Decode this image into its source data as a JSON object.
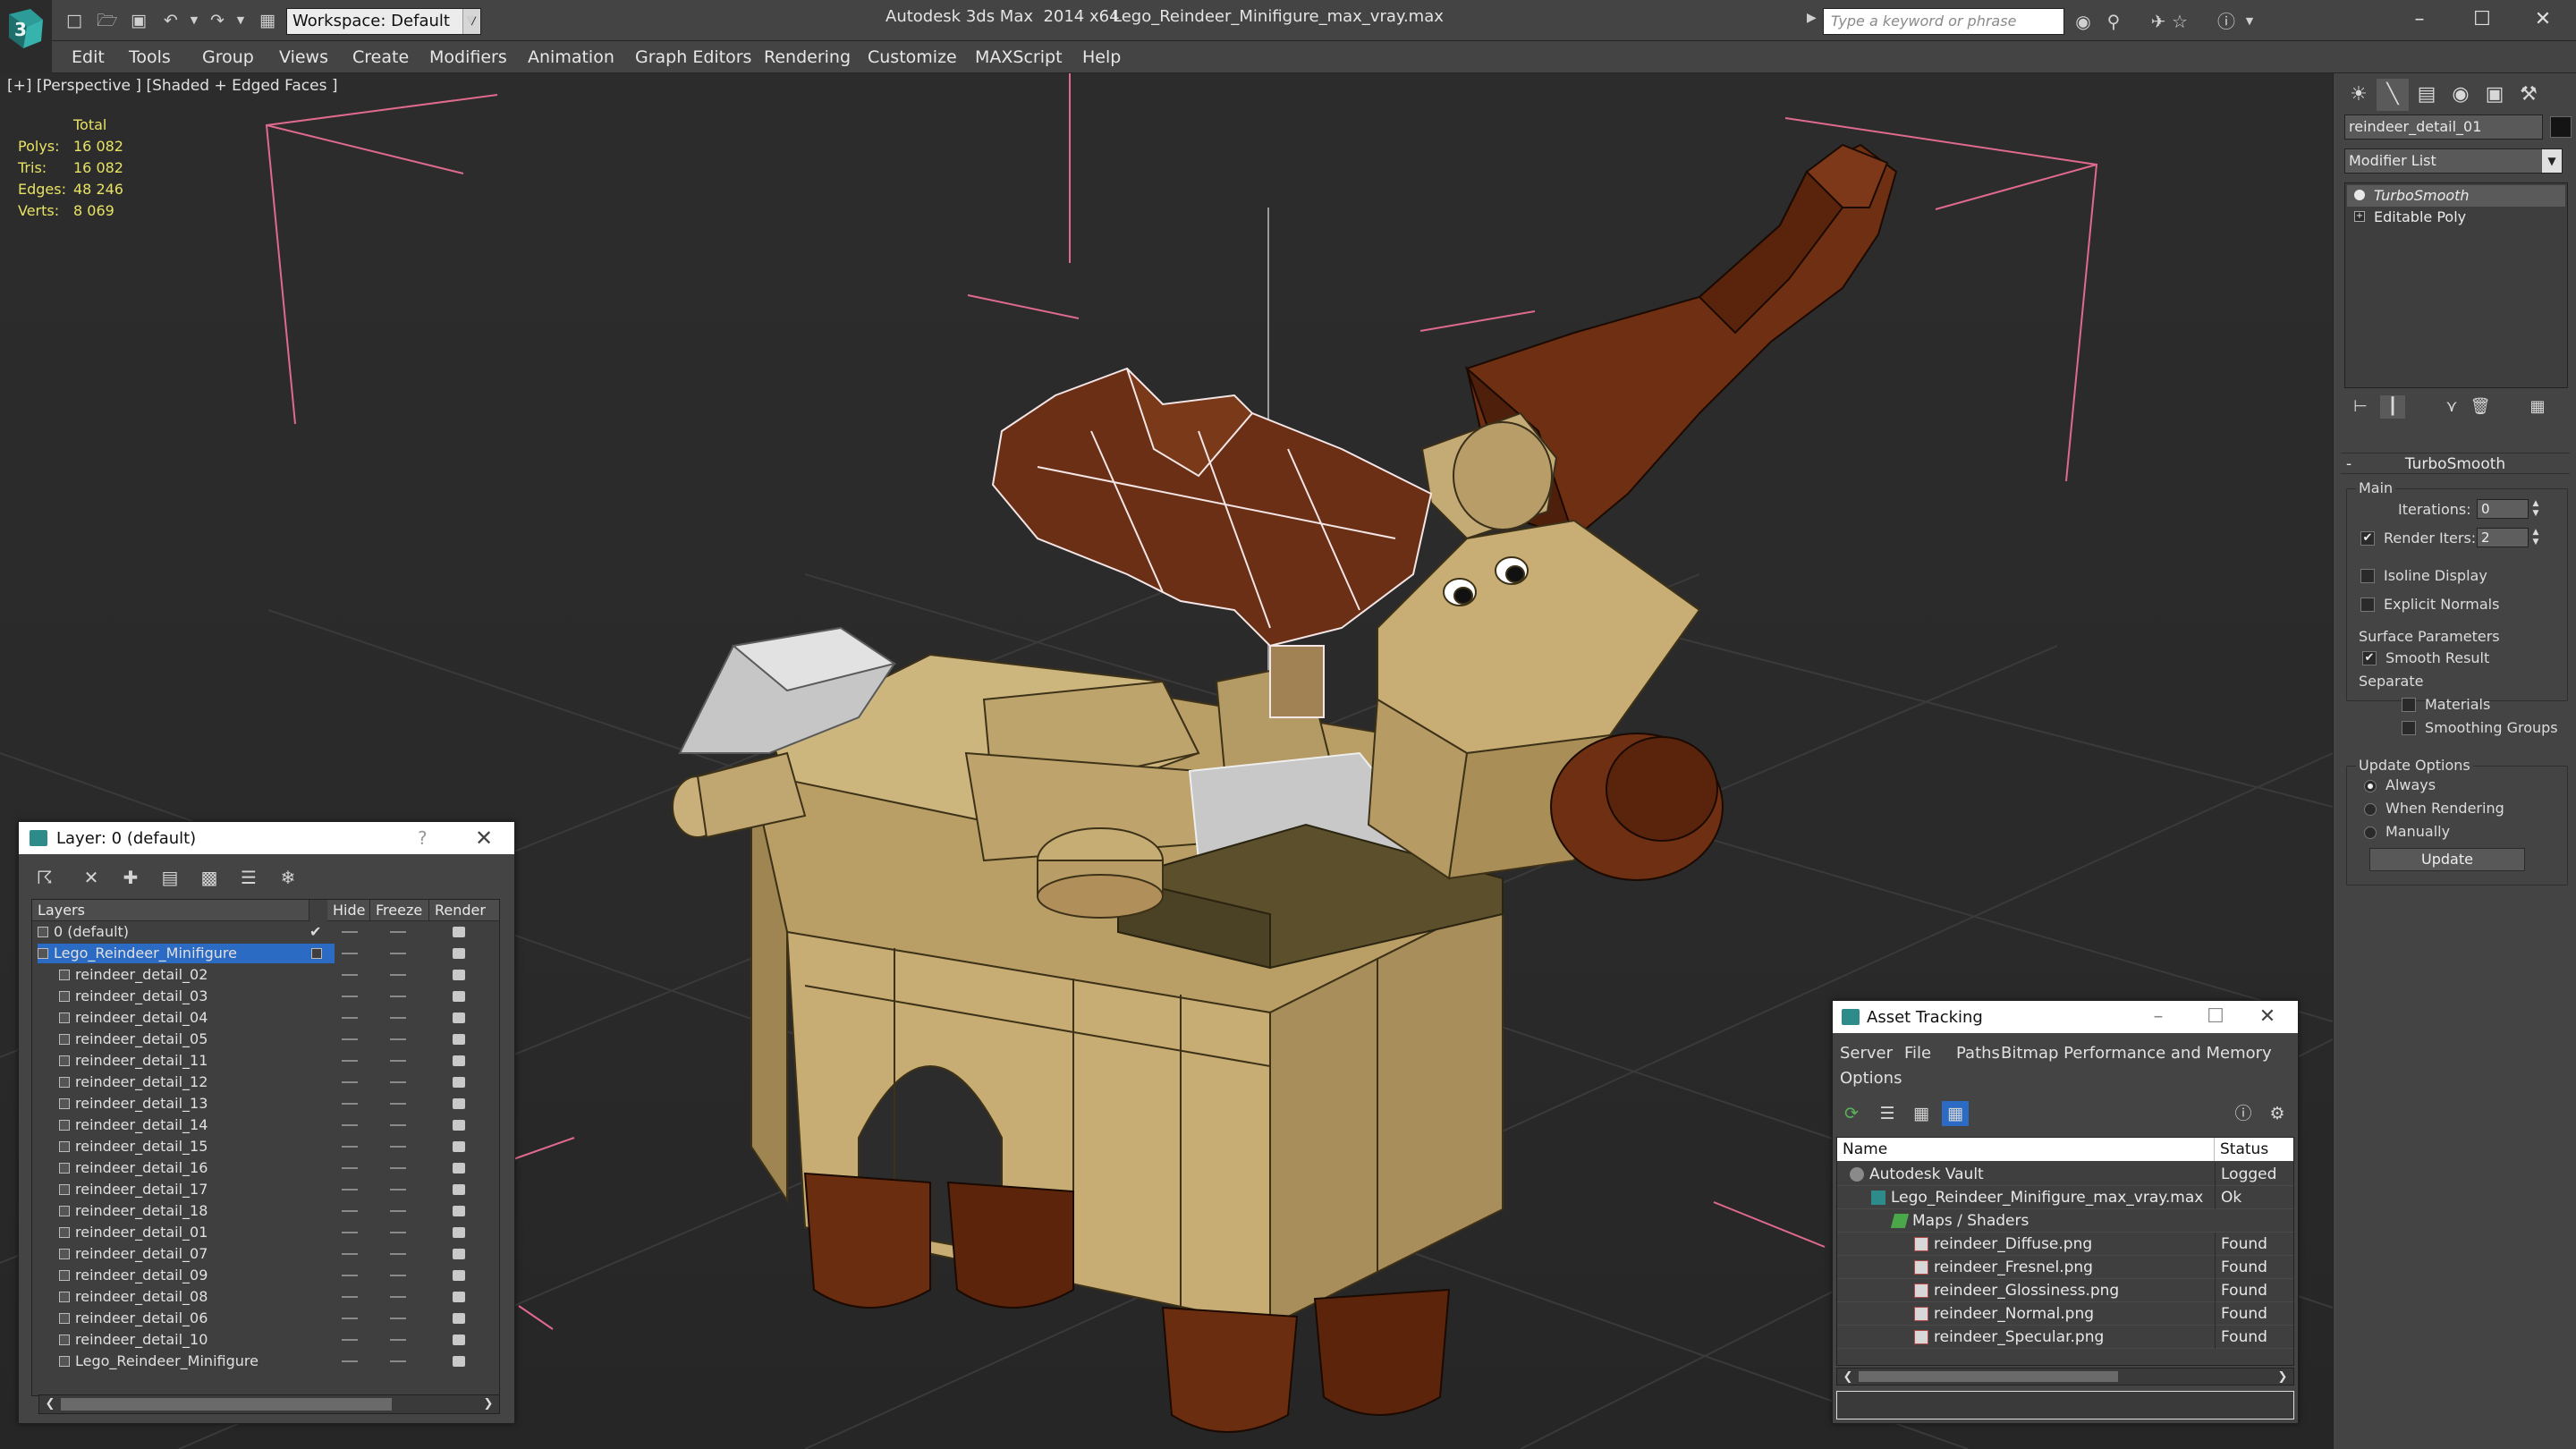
{
  "titlebar": {
    "workspace": "Workspace: Default",
    "app_title": "Autodesk 3ds Max  2014 x64",
    "file_title": "Lego_Reindeer_Minifigure_max_vray.max",
    "search_placeholder": "Type a keyword or phrase",
    "quick_access_icons": [
      "new-file-icon",
      "open-file-icon",
      "save-icon",
      "undo-icon",
      "redo-icon",
      "project-folder-icon"
    ],
    "toolbar_icons": [
      "binoculars-icon",
      "search-icon",
      "communication-icon",
      "favorites-star-icon",
      "help-icon"
    ],
    "window_buttons": {
      "minimize": "–",
      "maximize": "☐",
      "close": "✕"
    }
  },
  "menu": [
    "Edit",
    "Tools",
    "Group",
    "Views",
    "Create",
    "Modifiers",
    "Animation",
    "Graph Editors",
    "Rendering",
    "Customize",
    "MAXScript",
    "Help"
  ],
  "viewport": {
    "label": "[+] [Perspective ] [Shaded + Edged Faces ]",
    "stats": {
      "header": "Total",
      "rows": [
        {
          "label": "Polys:",
          "value": "16 082"
        },
        {
          "label": "Tris:",
          "value": "16 082"
        },
        {
          "label": "Edges:",
          "value": "48 246"
        },
        {
          "label": "Verts:",
          "value": "8 069"
        }
      ]
    },
    "colors": {
      "grid": "#3c3c3c",
      "tan": "#c9b27a",
      "brown": "#6b2d10",
      "selection": "#ff5a8a",
      "stats": "#e8e264"
    }
  },
  "command_panel": {
    "tabs": [
      "create-tab-icon",
      "modify-tab-icon",
      "hierarchy-tab-icon",
      "motion-tab-icon",
      "display-tab-icon",
      "utilities-tab-icon"
    ],
    "object_name": "reindeer_detail_01",
    "modifier_list": "Modifier List",
    "stack": [
      "TurboSmooth",
      "Editable Poly"
    ],
    "stack_tools": [
      "pin-stack-icon",
      "show-end-result-icon",
      "make-unique-icon",
      "remove-modifier-icon",
      "configure-sets-icon"
    ],
    "rollout": {
      "title": "TurboSmooth",
      "collapse": "-",
      "main_group": "Main",
      "iterations_label": "Iterations:",
      "iterations_value": "0",
      "render_iters_label": "Render Iters:",
      "render_iters_value": "2",
      "render_iters_checked": "✔",
      "isoline_label": "Isoline Display",
      "explicit_label": "Explicit Normals",
      "surface_group": "Surface Parameters",
      "smooth_result_label": "Smooth Result",
      "smooth_result_checked": "✔",
      "separate_label": "Separate",
      "materials_label": "Materials",
      "smoothing_groups_label": "Smoothing Groups",
      "update_group": "Update Options",
      "always_label": "Always",
      "when_rendering_label": "When Rendering",
      "manually_label": "Manually",
      "update_button": "Update"
    }
  },
  "layer_dialog": {
    "title": "Layer: 0 (default)",
    "help": "?",
    "close": "✕",
    "tool_icons": [
      "create-layer-icon",
      "delete-layer-icon",
      "add-to-layer-icon",
      "select-objects-icon",
      "highlight-layer-icon",
      "hide-all-icon",
      "freeze-all-icon"
    ],
    "columns": [
      "Layers",
      "Hide",
      "Freeze",
      "Render"
    ],
    "default_layer": "0 (default)",
    "default_check": "✔",
    "group_layer": "Lego_Reindeer_Minifigure",
    "objects": [
      "reindeer_detail_02",
      "reindeer_detail_03",
      "reindeer_detail_04",
      "reindeer_detail_05",
      "reindeer_detail_11",
      "reindeer_detail_12",
      "reindeer_detail_13",
      "reindeer_detail_14",
      "reindeer_detail_15",
      "reindeer_detail_16",
      "reindeer_detail_17",
      "reindeer_detail_18",
      "reindeer_detail_01",
      "reindeer_detail_07",
      "reindeer_detail_09",
      "reindeer_detail_08",
      "reindeer_detail_06",
      "reindeer_detail_10",
      "Lego_Reindeer_Minifigure"
    ],
    "scroll_left": "❮",
    "scroll_right": "❯"
  },
  "asset_dialog": {
    "title": "Asset Tracking",
    "menu": [
      "Server",
      "File",
      "Paths",
      "Bitmap Performance and Memory",
      "Options"
    ],
    "tool_icons": [
      "refresh-icon",
      "list-view-icon",
      "thumbnail-view-icon",
      "table-view-icon",
      "vault-help-icon",
      "vault-settings-icon"
    ],
    "columns": [
      "Name",
      "Status"
    ],
    "rows": [
      {
        "name": "Autodesk Vault",
        "status": "Logged O",
        "level": 0,
        "icon": "vault"
      },
      {
        "name": "Lego_Reindeer_Minifigure_max_vray.max",
        "status": "Ok",
        "level": 1,
        "icon": "max"
      },
      {
        "name": "Maps / Shaders",
        "status": "",
        "level": 2,
        "icon": "folder"
      },
      {
        "name": "reindeer_Diffuse.png",
        "status": "Found",
        "level": 3,
        "icon": "png"
      },
      {
        "name": "reindeer_Fresnel.png",
        "status": "Found",
        "level": 3,
        "icon": "png"
      },
      {
        "name": "reindeer_Glossiness.png",
        "status": "Found",
        "level": 3,
        "icon": "png"
      },
      {
        "name": "reindeer_Normal.png",
        "status": "Found",
        "level": 3,
        "icon": "png"
      },
      {
        "name": "reindeer_Specular.png",
        "status": "Found",
        "level": 3,
        "icon": "png"
      }
    ],
    "scroll_left": "❮",
    "scroll_right": "❯"
  }
}
